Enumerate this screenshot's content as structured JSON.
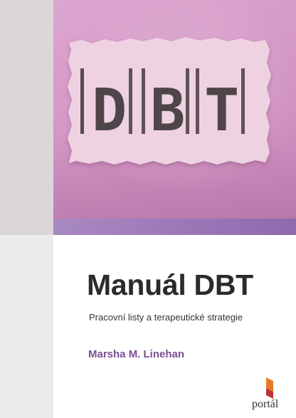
{
  "cover": {
    "paper_letters": [
      "D",
      "B",
      "T"
    ],
    "title": "Manuál DBT",
    "subtitle": "Pracovní listy a terapeutické strategie",
    "author": "Marsha M. Linehan",
    "publisher": "portál"
  },
  "colors": {
    "photo_background": "#d497c5",
    "paper": "#efd2e2",
    "stamp_ink": "#3a3235",
    "purple_band": "#9b7ab8",
    "title_text": "#2b2b2b",
    "author_text": "#7b4f93",
    "publisher_mark_orange": "#e8792b",
    "publisher_mark_red": "#c0332f"
  },
  "icons": {
    "publisher_logo": "portal-logo-icon"
  }
}
